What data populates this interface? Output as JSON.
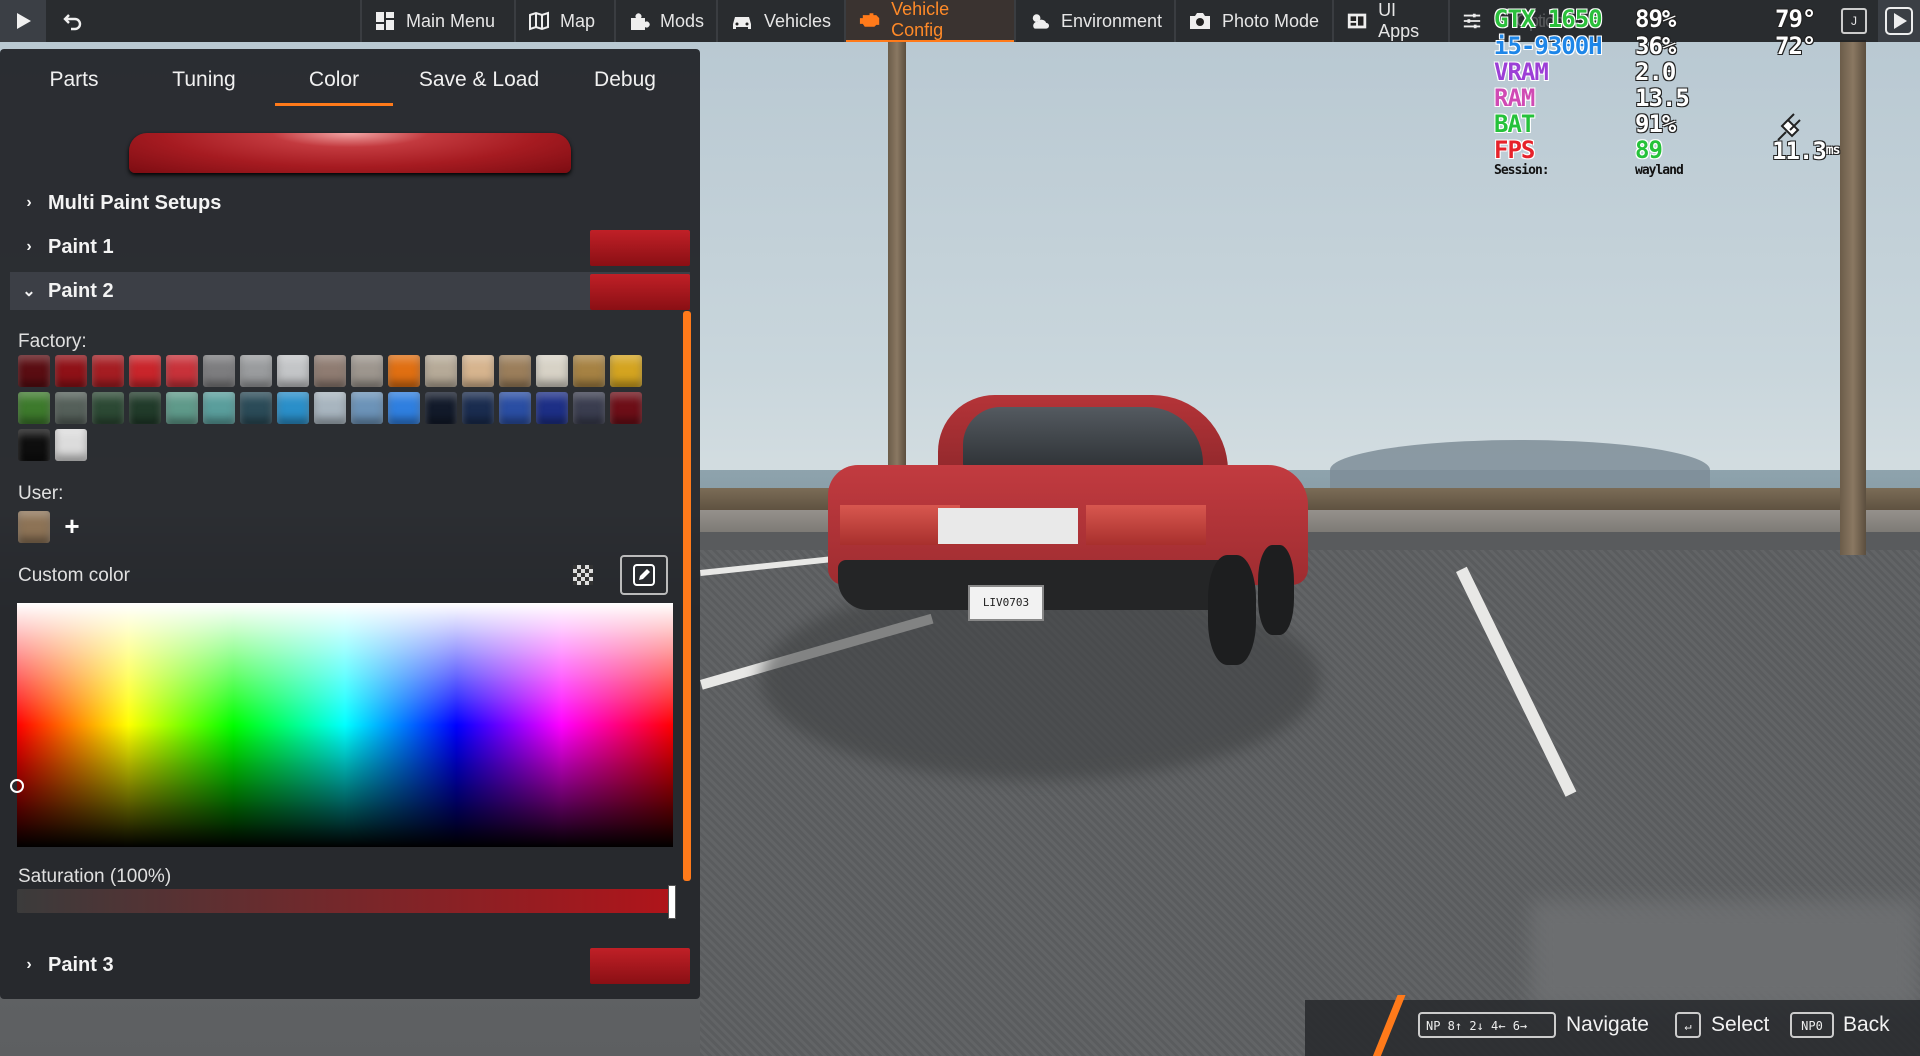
{
  "topbar": {
    "play_icon": "play-icon",
    "undo_icon": "undo-icon",
    "items": [
      {
        "label": "Main Menu",
        "icon": "dashboard-icon"
      },
      {
        "label": "Map",
        "icon": "map-icon"
      },
      {
        "label": "Mods",
        "icon": "puzzle-icon"
      },
      {
        "label": "Vehicles",
        "icon": "car-icon"
      },
      {
        "label": "Vehicle Config",
        "icon": "engine-icon",
        "active": true
      },
      {
        "label": "Environment",
        "icon": "weather-icon"
      },
      {
        "label": "Photo Mode",
        "icon": "camera-icon"
      },
      {
        "label": "UI Apps",
        "icon": "apps-icon"
      }
    ],
    "settings_icon": "sliders-icon",
    "right_key": "J",
    "right_play_icon": "play-icon"
  },
  "hud": {
    "gpu": {
      "name": "GTX 1650",
      "value": "89%",
      "temp": "79°"
    },
    "cpu": {
      "name": "i5-9300H",
      "value": "36%",
      "temp": "72°"
    },
    "vram": {
      "name": "VRAM",
      "value": "2.0"
    },
    "ram": {
      "name": "RAM",
      "value": "13.5"
    },
    "bat": {
      "name": "BAT",
      "value": "91%"
    },
    "fps": {
      "name": "FPS",
      "value": "89",
      "frametime": "11.3",
      "frametime_unit": "ms"
    },
    "session_label": "Session:",
    "session_value": "wayland",
    "hidden_text": "Options",
    "colors": {
      "gpu": "#2bbf3c",
      "cpu": "#1e86e8",
      "vram": "#9c3fd6",
      "ram": "#d04ab4",
      "bat": "#25c23a",
      "fps": "#e6222a"
    }
  },
  "panel": {
    "tabs": [
      {
        "label": "Parts"
      },
      {
        "label": "Tuning"
      },
      {
        "label": "Color",
        "active": true
      },
      {
        "label": "Save & Load"
      },
      {
        "label": "Debug"
      }
    ],
    "accordion": {
      "multi": "Multi Paint Setups",
      "paint1": "Paint 1",
      "paint2": "Paint 2",
      "paint3": "Paint 3"
    },
    "factory_label": "Factory:",
    "user_label": "User:",
    "custom_label": "Custom color",
    "saturation_label": "Saturation (100%)",
    "add_icon": "+",
    "factory_colors": [
      "#5a0d12",
      "#8f1117",
      "#a51d22",
      "#c9252b",
      "#c8323a",
      "#7d7d7f",
      "#9a9c9e",
      "#c3c5c7",
      "#8f7c72",
      "#9d968e",
      "#e06f12",
      "#b6aa98",
      "#d6b48e",
      "#9b7e5b",
      "#d7d2c6",
      "#a68243",
      "#d4a420",
      "#3d7a2c",
      "#55605a",
      "#2c4934",
      "#213b2a",
      "#5f9a8a",
      "#5a9e9c",
      "#2b4b58",
      "#2a8fc9",
      "#a8b5bf",
      "#6c93b8",
      "#2f7fe0",
      "#121a2a",
      "#1a2c4f",
      "#2a4ea3",
      "#1d2f86",
      "#3a3d4f",
      "#6d0e17",
      "#0e0e0e",
      "#dcdcdc"
    ],
    "user_colors": [
      "#8d7356"
    ],
    "accent": "#ff7a1a",
    "paint_color": "#a61b21"
  },
  "bottom": {
    "navigate_key": "NP 8↑ 2↓ 4← 6→",
    "navigate_label": "Navigate",
    "select_key": "↵",
    "select_label": "Select",
    "back_key": "NP0",
    "back_label": "Back"
  },
  "scene": {
    "plate_text": "LIV0703"
  }
}
